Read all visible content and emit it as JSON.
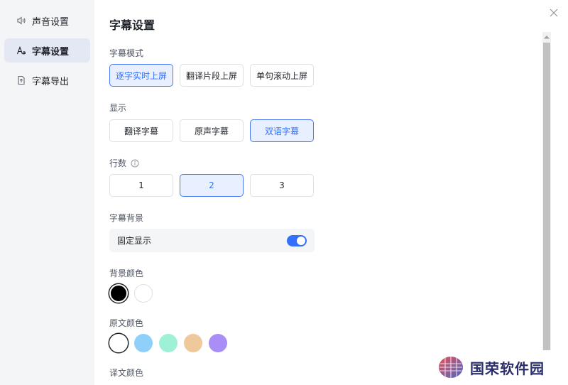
{
  "sidebar": {
    "items": [
      {
        "label": "声音设置",
        "icon": "speaker-icon",
        "active": false
      },
      {
        "label": "字幕设置",
        "icon": "font-icon",
        "active": true
      },
      {
        "label": "字幕导出",
        "icon": "export-icon",
        "active": false
      }
    ]
  },
  "main": {
    "title": "字幕设置",
    "subtitle_mode": {
      "label": "字幕模式",
      "options": [
        "逐字实时上屏",
        "翻译片段上屏",
        "单句滚动上屏"
      ],
      "selected": 0
    },
    "display": {
      "label": "显示",
      "options": [
        "翻译字幕",
        "原声字幕",
        "双语字幕"
      ],
      "selected": 2
    },
    "lines": {
      "label": "行数",
      "options": [
        "1",
        "2",
        "3"
      ],
      "selected": 1
    },
    "background": {
      "label": "字幕背景",
      "fixed_label": "固定显示",
      "fixed_on": true
    },
    "bg_color": {
      "label": "背景颜色",
      "colors": [
        "#000000",
        "#ffffff"
      ],
      "selected": 0
    },
    "original_color": {
      "label": "原文颜色",
      "colors": [
        "#ffffff",
        "#8fd0fb",
        "#9ef0d6",
        "#efc99c",
        "#a98ef7"
      ],
      "selected": 0
    },
    "translation_color": {
      "label": "译文颜色"
    }
  },
  "watermark": {
    "text": "国荣软件园"
  },
  "colors": {
    "accent": "#3370ff",
    "selected_bg": "#e8efff"
  }
}
